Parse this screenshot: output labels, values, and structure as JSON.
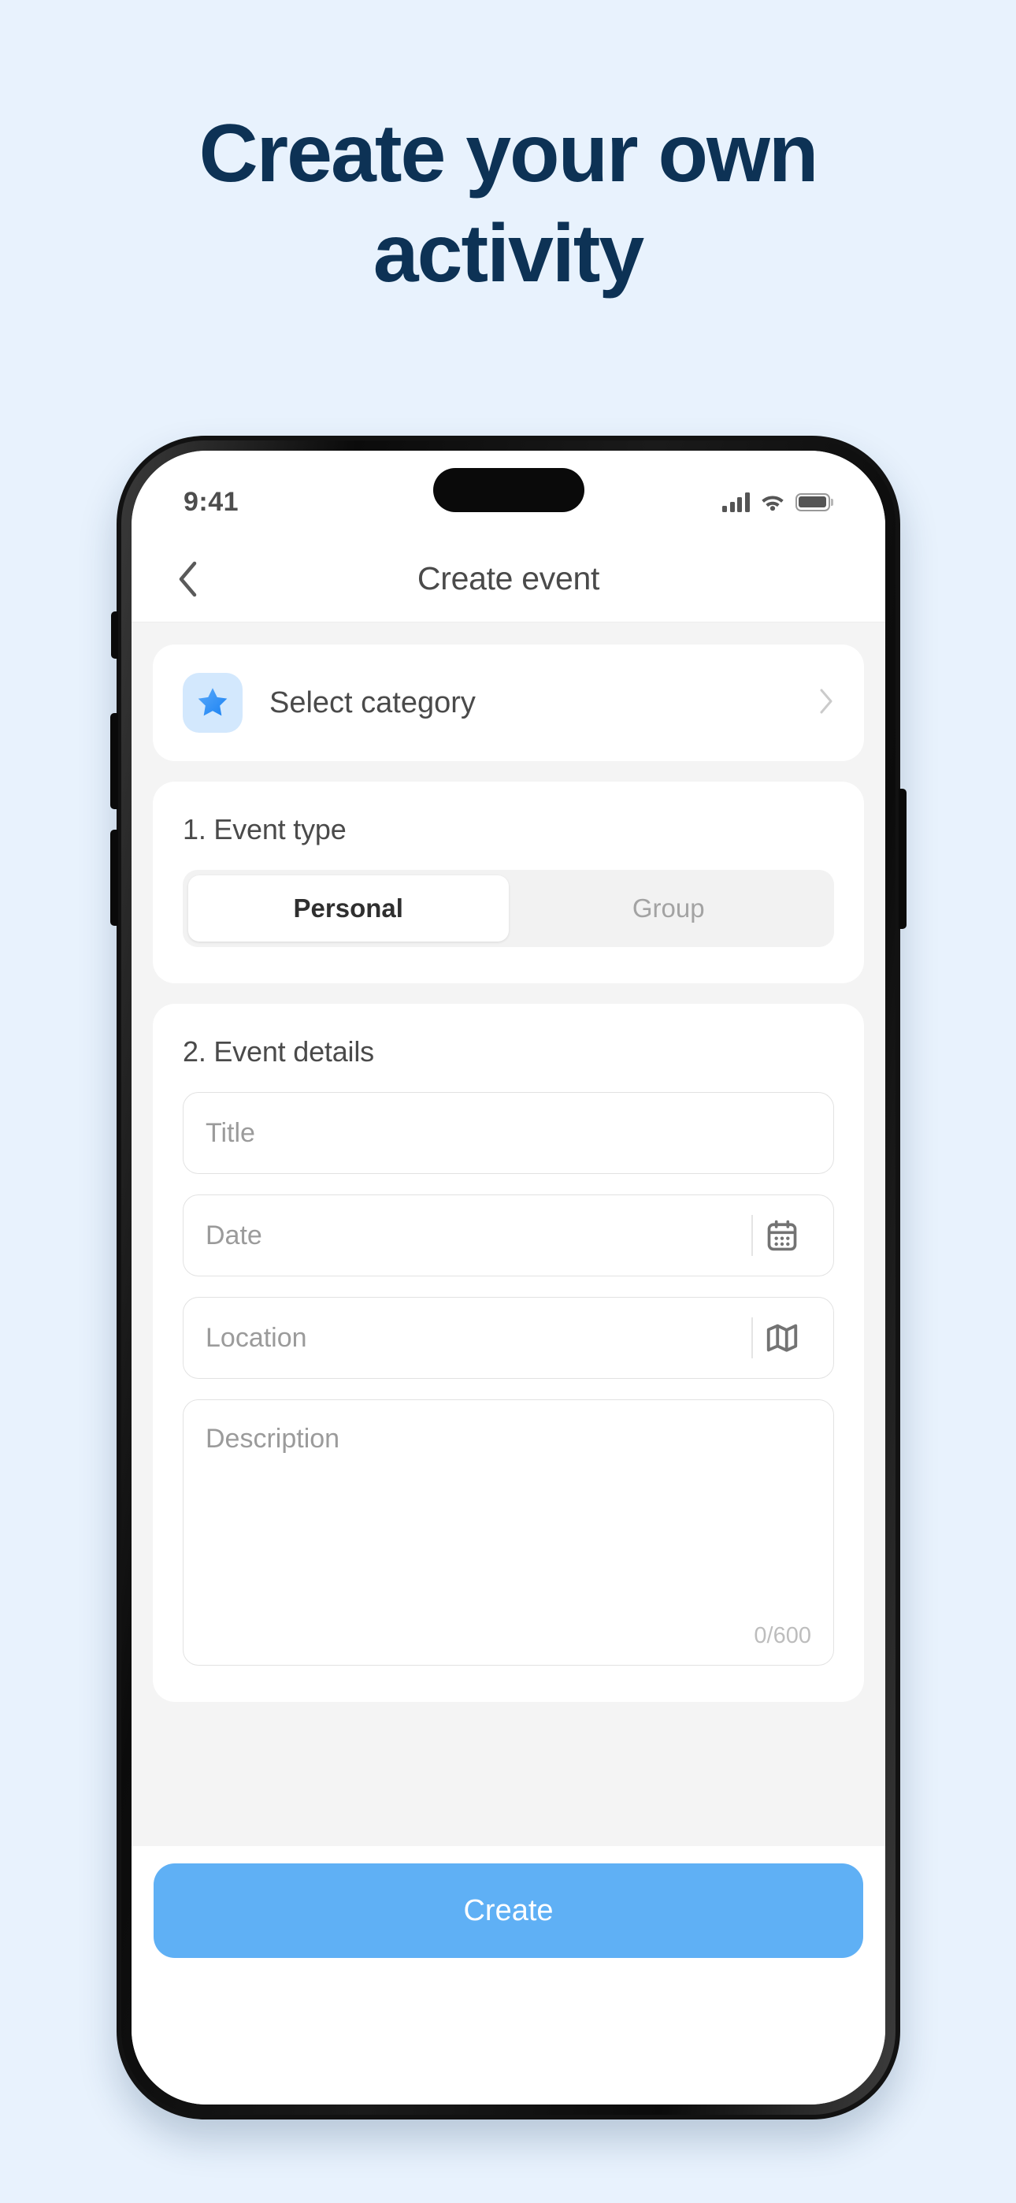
{
  "promo": {
    "headline_line1": "Create your own",
    "headline_line2": "activity",
    "headline_color": "#0d3255",
    "background_color": "#e8f2fd"
  },
  "statusbar": {
    "time": "9:41",
    "signal_icon": "cellular-signal-icon",
    "wifi_icon": "wifi-icon",
    "battery_icon": "battery-icon"
  },
  "navbar": {
    "back_icon": "chevron-left-icon",
    "title": "Create event"
  },
  "category_card": {
    "icon": "star-icon",
    "icon_color": "#2e93f7",
    "icon_bg": "#d3e8fd",
    "label": "Select category",
    "chevron_icon": "chevron-right-icon"
  },
  "event_type": {
    "title": "1. Event type",
    "options": [
      {
        "label": "Personal",
        "selected": true
      },
      {
        "label": "Group",
        "selected": false
      }
    ]
  },
  "event_details": {
    "title": "2. Event details",
    "fields": [
      {
        "placeholder": "Title",
        "icon": null
      },
      {
        "placeholder": "Date",
        "icon": "calendar-icon"
      },
      {
        "placeholder": "Location",
        "icon": "map-icon"
      }
    ],
    "description": {
      "placeholder": "Description",
      "char_count": "0/600",
      "max_length": 600
    }
  },
  "bottom_bar": {
    "create_label": "Create",
    "create_color": "#5fb0f5"
  }
}
